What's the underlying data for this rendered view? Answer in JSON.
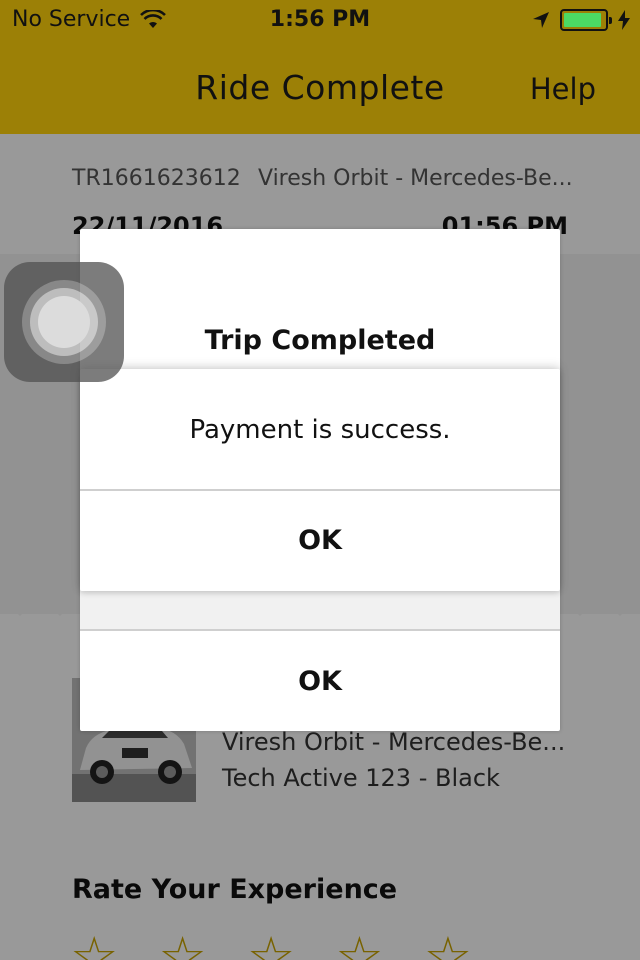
{
  "status_bar": {
    "carrier": "No Service",
    "time": "1:56 PM",
    "icons": [
      "wifi-icon",
      "location-arrow-icon",
      "battery-icon",
      "charging-bolt-icon"
    ],
    "battery_color": "#4cd964"
  },
  "nav": {
    "title": "Ride Complete",
    "help_label": "Help",
    "bar_color": "#9c8006"
  },
  "trip": {
    "id": "TR1661623612",
    "vehicle_short": "Viresh Orbit - Mercedes-Be...",
    "date": "22/11/2016",
    "time": "01:56 PM"
  },
  "vehicle": {
    "name": "Viresh Orbit - Mercedes-Be...",
    "plate_color": "Tech Active 123 - Black"
  },
  "rating": {
    "title": "Rate Your Experience",
    "max_stars": 5,
    "star_color": "#c9a400"
  },
  "alert_back": {
    "title": "Trip Completed",
    "ok_label": "OK"
  },
  "alert_front": {
    "message": "Payment is success.",
    "ok_label": "OK"
  }
}
